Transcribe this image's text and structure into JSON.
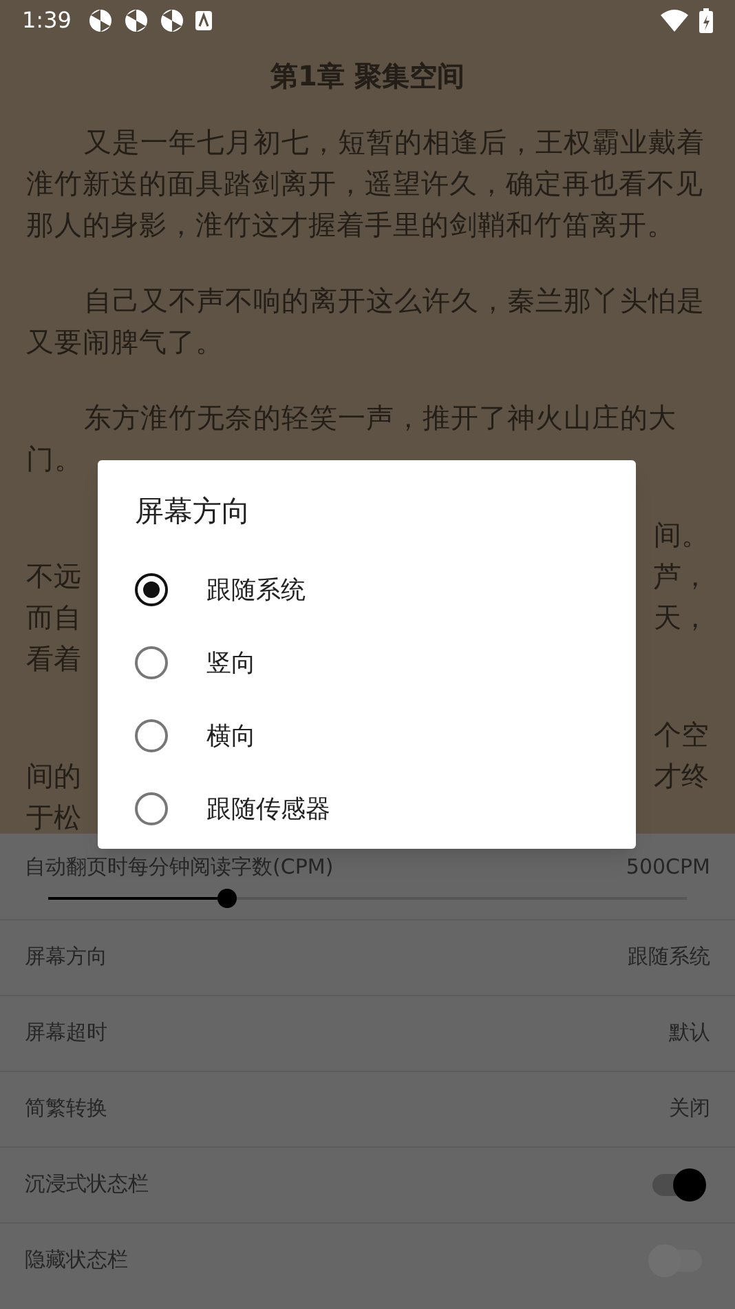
{
  "status_bar": {
    "time": "1:39"
  },
  "chapter": {
    "title": "第1章 聚集空间",
    "paragraphs": [
      "又是一年七月初七，短暂的相逢后，王权霸业戴着淮竹新送的面具踏剑离开，遥望许久，确定再也看不见那人的身影，淮竹这才握着手里的剑鞘和竹笛离开。",
      "自己又不声不响的离开这么许久，秦兰那丫头怕是又要闹脾气了。",
      "东方淮竹无奈的轻笑一声，推开了神火山庄的大门。"
    ],
    "covered_paragraphs": [
      [
        {
          "right": "间。"
        },
        {
          "left": "不远",
          "right": "芦，"
        },
        {
          "left": "而自",
          "right": "天，"
        },
        {
          "left": "看着"
        }
      ],
      [
        {
          "right": "个空"
        },
        {
          "left": "间的",
          "right": "才终"
        },
        {
          "left": "于松"
        }
      ]
    ]
  },
  "settings": {
    "cpm": {
      "label": "自动翻页时每分钟阅读字数(CPM)",
      "reading": "500CPM",
      "level": 0.28
    },
    "rows": [
      {
        "kind": "value",
        "label": "屏幕方向",
        "value": "跟随系统"
      },
      {
        "kind": "value",
        "label": "屏幕超时",
        "value": "默认"
      },
      {
        "kind": "value",
        "label": "简繁转换",
        "value": "关闭"
      },
      {
        "kind": "switch",
        "label": "沉浸式状态栏",
        "on": true
      },
      {
        "kind": "switch",
        "label": "隐藏状态栏",
        "on": false
      }
    ]
  },
  "dialog": {
    "title": "屏幕方向",
    "options": [
      {
        "label": "跟随系统",
        "selected": true
      },
      {
        "label": "竖向",
        "selected": false
      },
      {
        "label": "横向",
        "selected": false
      },
      {
        "label": "跟随传感器",
        "selected": false
      }
    ]
  }
}
